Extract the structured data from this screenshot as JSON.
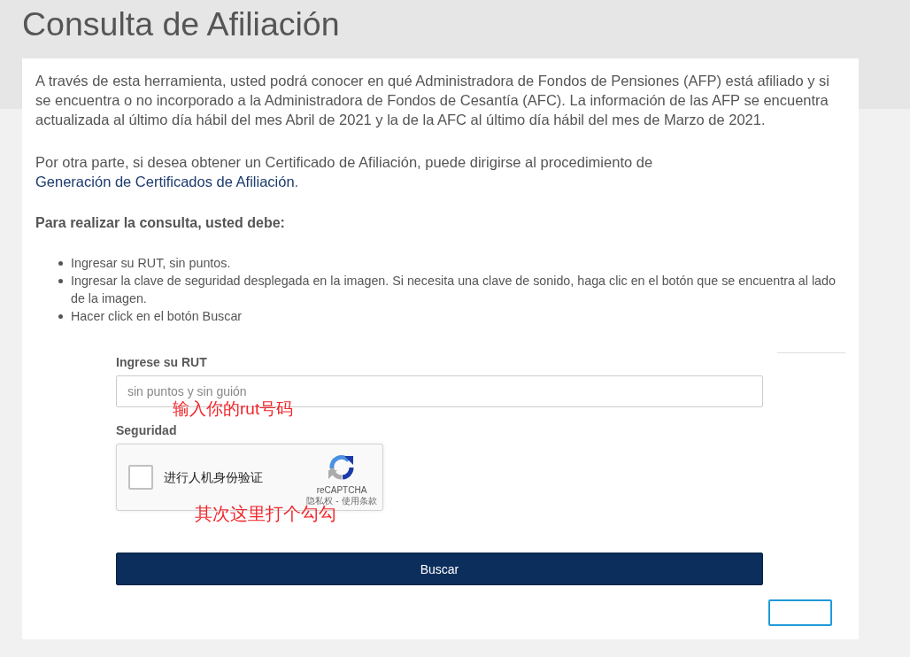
{
  "page": {
    "title": "Consulta de Afiliación"
  },
  "intro": {
    "paragraph": "A través de esta herramienta, usted podrá conocer en qué Administradora de Fondos de Pensiones (AFP) está afiliado y si se encuentra o no incorporado a la Administradora de Fondos de Cesantía (AFC). La información de las AFP se encuentra actualizada al último día hábil del mes Abril de 2021 y la de la AFC al último día hábil del mes de Marzo de 2021.",
    "certificate_note": {
      "text": "Por otra parte, si desea obtener un Certificado de Afiliación, puede dirigirse al procedimiento de",
      "link": "Generación de Certificados de Afiliación",
      "end": "."
    }
  },
  "instructions": {
    "heading": "Para realizar la consulta, usted debe:",
    "steps": [
      "Ingresar su RUT, sin puntos.",
      "Ingresar la clave de seguridad desplegada en la imagen. Si necesita una clave de sonido, haga clic en el botón que se encuentra al lado de la imagen.",
      "Hacer click en el botón Buscar"
    ]
  },
  "form": {
    "rut": {
      "label": "Ingrese su RUT",
      "placeholder": "sin puntos y sin guión",
      "annotation": "输入你的rut号码"
    },
    "security": {
      "label": "Seguridad",
      "captcha": {
        "checked": false,
        "label": "进行人机身份验证",
        "brand": "reCAPTCHA",
        "links": [
          "隐私权",
          "使用条款"
        ],
        "separator": "-",
        "annotation": "其次这里打个勾勾"
      }
    },
    "submit": {
      "label": "Buscar"
    }
  }
}
